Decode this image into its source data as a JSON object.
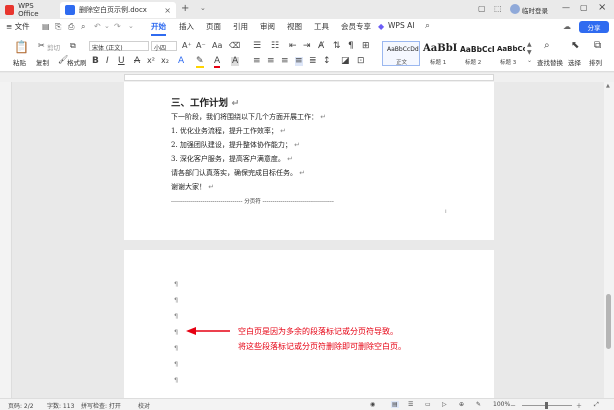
{
  "titlebar": {
    "app_tab": "WPS Office",
    "doc_tab": "删除空白页示例.docx",
    "add_tab": "+",
    "login": "临时登录"
  },
  "menubar": {
    "file": "≡ 文件",
    "items": [
      "开始",
      "插入",
      "页面",
      "引用",
      "审阅",
      "视图",
      "工具",
      "会员专享"
    ],
    "active": "开始",
    "ai": "WPS AI",
    "share": "分享"
  },
  "ribbon": {
    "paste": "粘贴",
    "cut": "剪切",
    "copy": "复制",
    "format_painter": "格式刷",
    "font_name": "宋体 (正文)",
    "font_size": "小四",
    "styles": [
      {
        "preview": "AaBbCcDd",
        "label": "正文"
      },
      {
        "preview": "AaBbI",
        "label": "标题 1"
      },
      {
        "preview": "AaBbCcI",
        "label": "标题 2"
      },
      {
        "preview": "AaBbCc",
        "label": "标题 3"
      }
    ],
    "find_replace": "查找替换",
    "select": "选择",
    "arrange": "排列"
  },
  "document": {
    "page1": {
      "heading": "三、工作计划",
      "lines": [
        "下一阶段，我们将围绕以下几个方面开展工作：",
        "1. 优化业务流程，提升工作效率；",
        "2. 加强团队建设，提升整体协作能力；",
        "3. 深化客户服务，提高客户满意度。",
        "请各部门认真落实，确保完成目标任务。",
        "谢谢大家！"
      ],
      "page_break": "------------------------------------ 分页符 ------------------------------------"
    },
    "page2": {
      "annotation": [
        "空白页是因为多余的段落标记或分页符导致。",
        "将这些段落标记或分页符删除即可删除空白页。"
      ]
    }
  },
  "statusbar": {
    "page": "页码: 2/2",
    "words": "字数: 113",
    "spellcheck": "拼写检查: 打开",
    "proofread": "校对",
    "zoom": "100%"
  },
  "colors": {
    "accent": "#2f6bf0",
    "annotation": "#e60012",
    "share_button": "#2f6bf0"
  }
}
